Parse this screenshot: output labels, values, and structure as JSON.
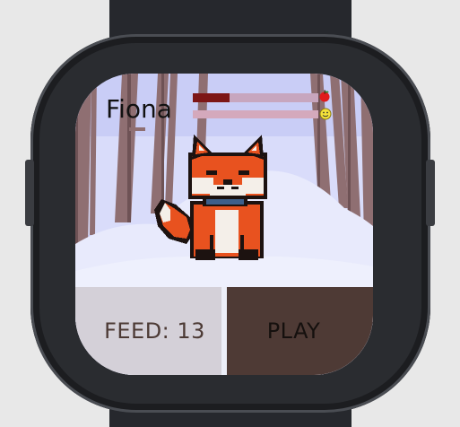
{
  "pet": {
    "name": "Fiona"
  },
  "stats": {
    "hunger": {
      "level": 0.29,
      "icon": "apple-icon",
      "color": "#7d1616"
    },
    "happiness": {
      "level": 0.0,
      "icon": "smiley-icon"
    }
  },
  "buttons": {
    "feed_label": "FEED: 13",
    "play_label": "PLAY"
  },
  "colors": {
    "feed_bg": "#d4d0d8",
    "play_bg": "#4e3a35",
    "sky": "#c9cdf6",
    "snow": "#eef0fd"
  }
}
